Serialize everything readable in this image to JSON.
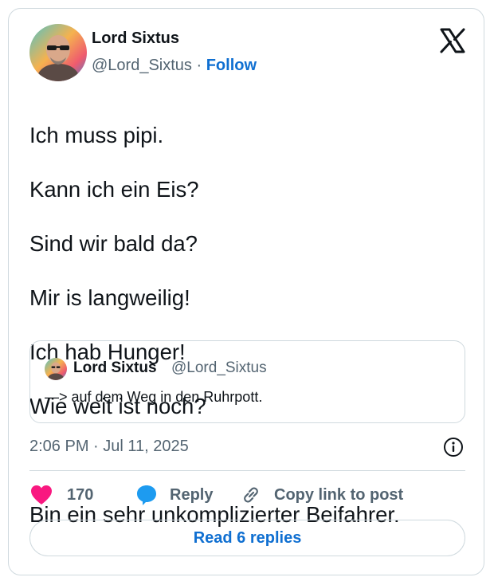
{
  "author": {
    "name": "Lord Sixtus",
    "handle": "@Lord_Sixtus",
    "separator": "·",
    "follow_label": "Follow"
  },
  "tweet": {
    "lines": [
      "Ich muss pipi.",
      "Kann ich ein Eis?",
      "Sind wir bald da?",
      "Mir is langweilig!",
      "Ich hab Hunger!",
      "Wie weit ist noch?",
      "",
      "Bin ein sehr unkomplizierter Beifahrer."
    ]
  },
  "quote": {
    "name": "Lord Sixtus",
    "handle": "@Lord_Sixtus",
    "text": "—> auf dem Weg in den Ruhrpott."
  },
  "timestamp": "2:06 PM · Jul 11, 2025",
  "actions": {
    "likes": "170",
    "reply_label": "Reply",
    "copy_label": "Copy link to post"
  },
  "read_replies_label": "Read 6 replies",
  "colors": {
    "accent": "#0f6fd1",
    "like": "#f91880",
    "reply_icon": "#1d9bf0",
    "border": "#cfd9de",
    "secondary_text": "#536471"
  },
  "icons": [
    "x-logo-icon",
    "info-icon",
    "heart-icon",
    "reply-bubble-icon",
    "link-icon"
  ]
}
